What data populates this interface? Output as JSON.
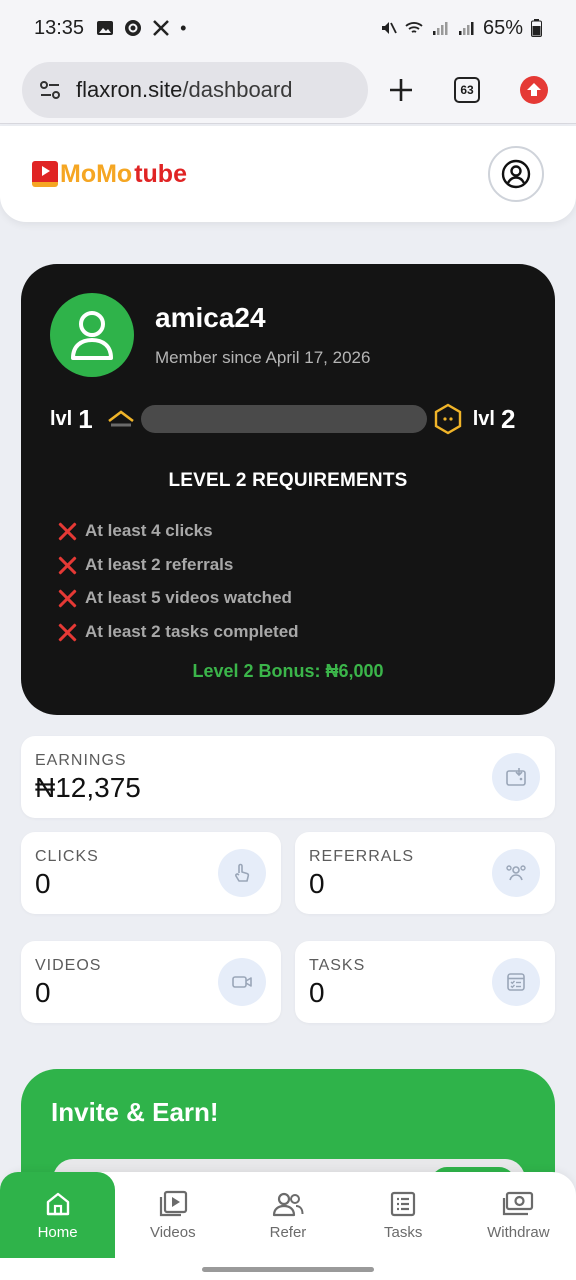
{
  "status_bar": {
    "time": "13:35",
    "battery": "65%"
  },
  "browser": {
    "url_domain": "flaxron.site",
    "url_path": "/dashboard",
    "tab_count": "63"
  },
  "header": {
    "logo_part1": "MoMo",
    "logo_part2": "tube"
  },
  "profile": {
    "username": "amica24",
    "member_since": "Member since April 17, 2026",
    "current_level_prefix": "lvl",
    "current_level": "1",
    "next_level_prefix": "lvl",
    "next_level": "2",
    "level_progress": 0,
    "requirements_title": "LEVEL 2 REQUIREMENTS",
    "requirements": [
      "At least 4 clicks",
      "At least 2 referrals",
      "At least 5 videos watched",
      "At least 2 tasks completed"
    ],
    "bonus": "Level 2 Bonus: ₦6,000"
  },
  "stats": {
    "earnings": {
      "label": "EARNINGS",
      "value": "₦12,375"
    },
    "clicks": {
      "label": "CLICKS",
      "value": "0"
    },
    "referrals": {
      "label": "REFERRALS",
      "value": "0"
    },
    "videos": {
      "label": "VIDEOS",
      "value": "0"
    },
    "tasks": {
      "label": "TASKS",
      "value": "0"
    }
  },
  "invite": {
    "title": "Invite & Earn!"
  },
  "nav": [
    {
      "label": "Home",
      "icon": "home-icon"
    },
    {
      "label": "Videos",
      "icon": "video-library-icon"
    },
    {
      "label": "Refer",
      "icon": "people-icon"
    },
    {
      "label": "Tasks",
      "icon": "tasks-icon"
    },
    {
      "label": "Withdraw",
      "icon": "cash-icon"
    }
  ],
  "colors": {
    "accent_green": "#2fb34a",
    "card_dark": "#141414",
    "error_red": "#e53935",
    "level_gold": "#f0b429"
  }
}
